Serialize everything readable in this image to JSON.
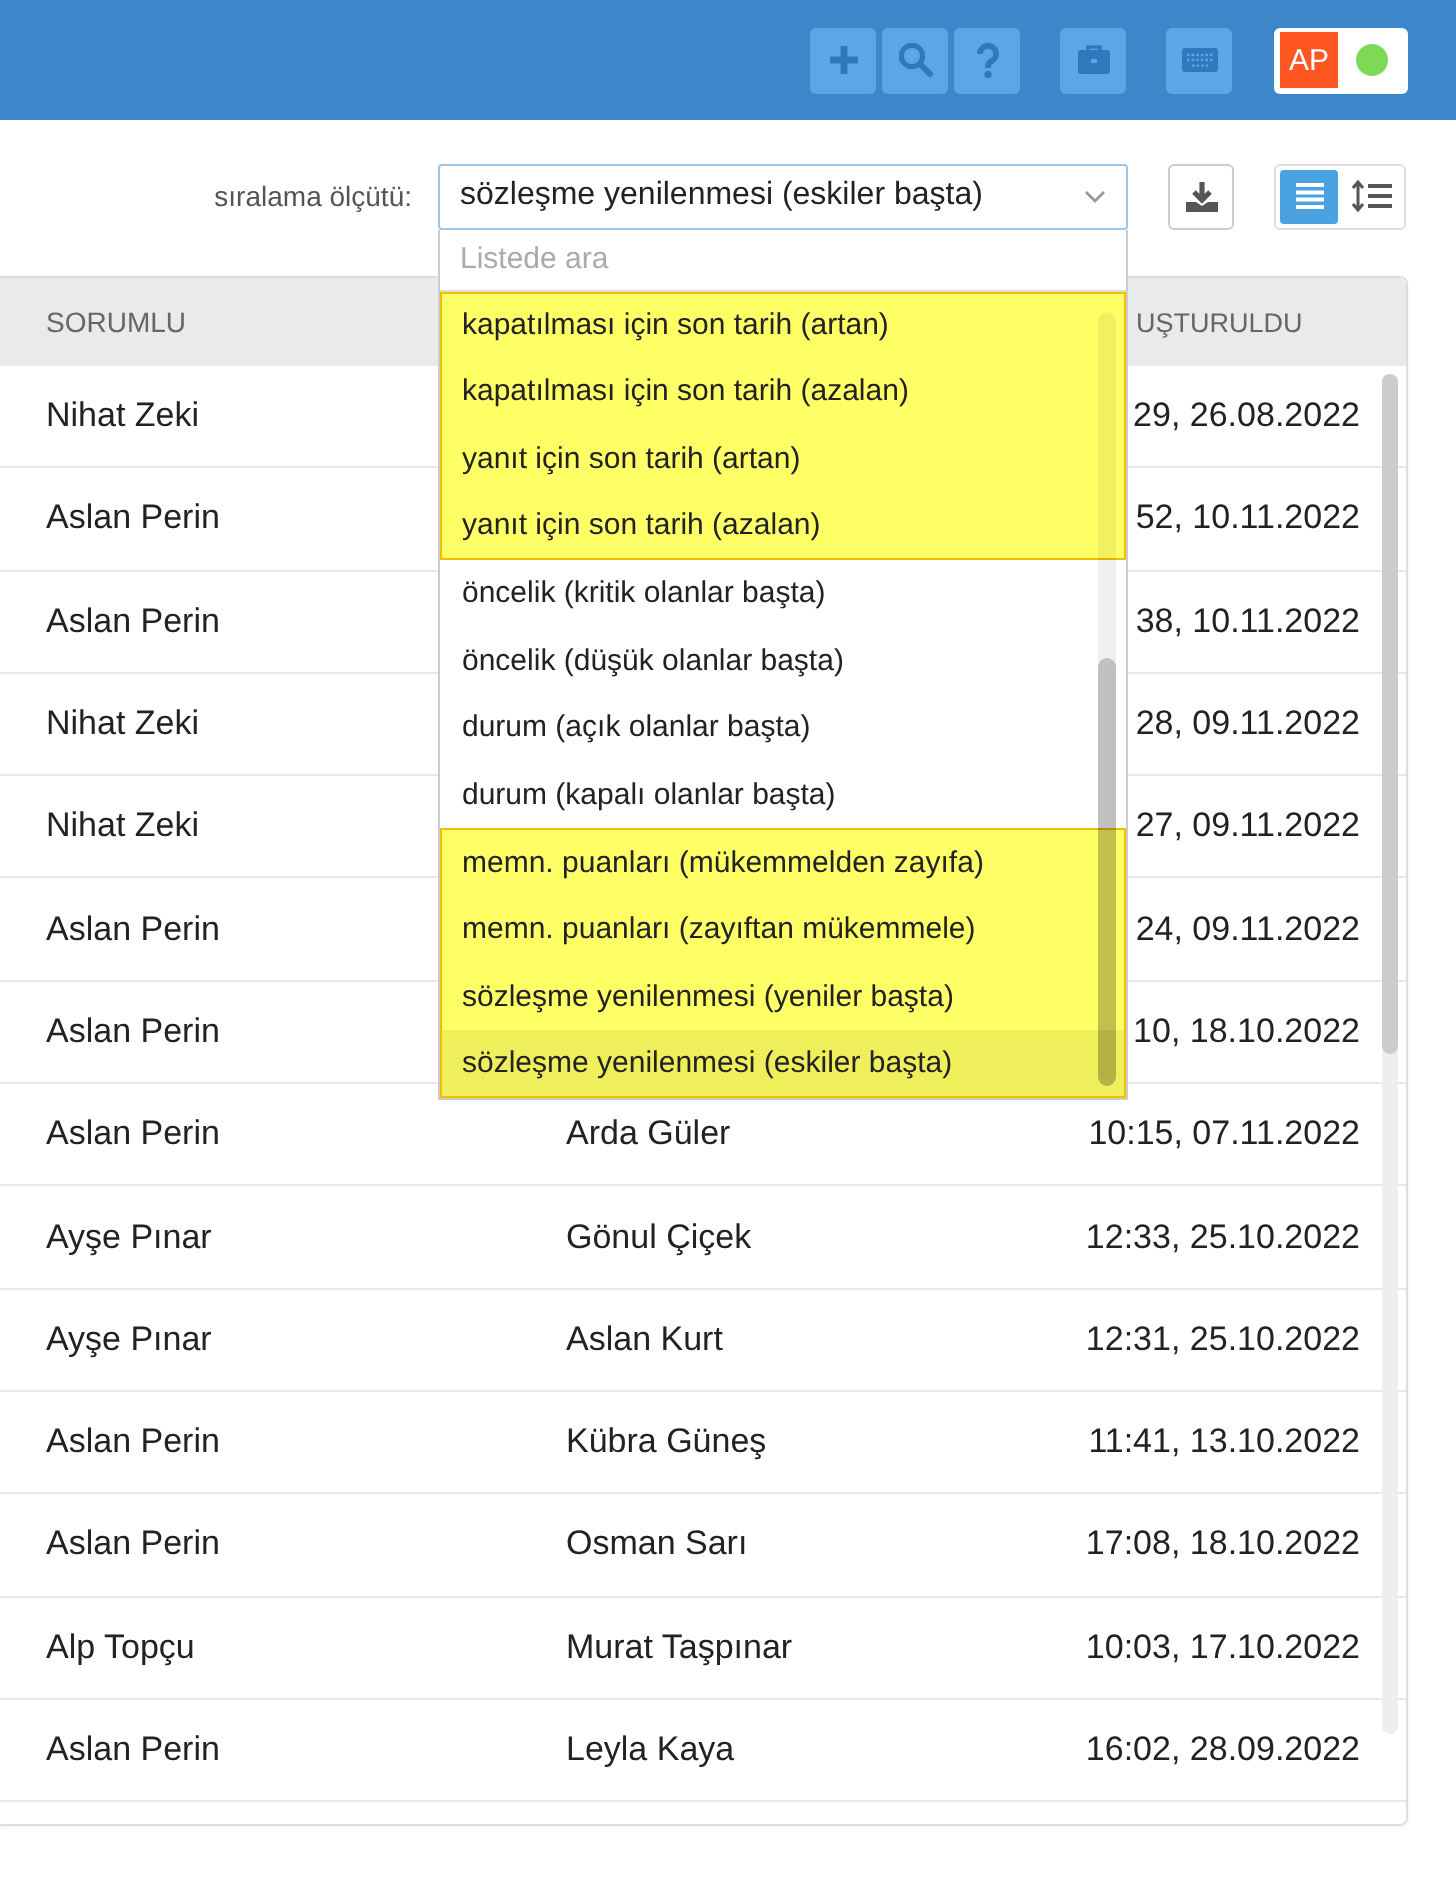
{
  "header": {
    "tool_buttons": [
      {
        "kind": "add"
      },
      {
        "kind": "search"
      },
      {
        "kind": "help"
      },
      {
        "kind": "briefcase"
      },
      {
        "kind": "keyboard"
      }
    ],
    "user": {
      "initials": "AP",
      "online": true
    }
  },
  "toolbar": {
    "sort_label": "sıralama ölçütü:",
    "sort_value": "sözleşme yenilenmesi (eskiler başta)",
    "view_modes": [
      {
        "kind": "list",
        "selected": true
      },
      {
        "kind": "compact",
        "selected": false
      }
    ]
  },
  "sort_dropdown": {
    "search_placeholder": "Listede ara",
    "options": [
      {
        "label": "kapatılması için son tarih (artan)",
        "highlighted": true,
        "selected": false
      },
      {
        "label": "kapatılması için son tarih (azalan)",
        "highlighted": true,
        "selected": false
      },
      {
        "label": "yanıt için son tarih (artan)",
        "highlighted": true,
        "selected": false
      },
      {
        "label": "yanıt için son tarih (azalan)",
        "highlighted": true,
        "selected": false
      },
      {
        "label": "öncelik (kritik olanlar başta)",
        "highlighted": false,
        "selected": false
      },
      {
        "label": "öncelik (düşük olanlar başta)",
        "highlighted": false,
        "selected": false
      },
      {
        "label": "durum (açık olanlar başta)",
        "highlighted": false,
        "selected": false
      },
      {
        "label": "durum (kapalı olanlar başta)",
        "highlighted": false,
        "selected": false
      },
      {
        "label": "memn. puanları (mükemmelden zayıfa)",
        "highlighted": true,
        "selected": false
      },
      {
        "label": "memn. puanları (zayıftan mükemmele)",
        "highlighted": true,
        "selected": false
      },
      {
        "label": "sözleşme yenilenmesi (yeniler başta)",
        "highlighted": true,
        "selected": false
      },
      {
        "label": "sözleşme yenilenmesi (eskiler başta)",
        "highlighted": true,
        "selected": true
      }
    ]
  },
  "table": {
    "headers": {
      "column_1": "SORUMLU",
      "column_3": "UŞTURULDU"
    },
    "rows": [
      {
        "column_1": "Nihat Zeki",
        "column_3": "29, 26.08.2022"
      },
      {
        "column_1": "Aslan Perin",
        "column_3": "52, 10.11.2022"
      },
      {
        "column_1": "Aslan Perin",
        "column_3": "38, 10.11.2022"
      },
      {
        "column_1": "Nihat Zeki",
        "column_3": "28, 09.11.2022"
      },
      {
        "column_1": "Nihat Zeki",
        "column_3": "27, 09.11.2022"
      },
      {
        "column_1": "Aslan Perin",
        "column_3": "24, 09.11.2022"
      },
      {
        "column_1": "Aslan Perin",
        "column_3": "10, 18.10.2022"
      },
      {
        "column_1": "Aslan Perin",
        "column_2": "Arda Güler",
        "column_3": "10:15, 07.11.2022"
      },
      {
        "column_1": "Ayşe Pınar",
        "column_2": "Gönul Çiçek",
        "column_3": "12:33, 25.10.2022"
      },
      {
        "column_1": "Ayşe Pınar",
        "column_2": "Aslan Kurt",
        "column_3": "12:31, 25.10.2022"
      },
      {
        "column_1": "Aslan Perin",
        "column_2": "Kübra Güneş",
        "column_3": "11:41, 13.10.2022"
      },
      {
        "column_1": "Aslan Perin",
        "column_2": "Osman Sarı",
        "column_3": "17:08, 18.10.2022"
      },
      {
        "column_1": "Alp Topçu",
        "column_2": "Murat Taşpınar",
        "column_3": "10:03, 17.10.2022"
      },
      {
        "column_1": "Aslan Perin",
        "column_2": "Leyla Kaya",
        "column_3": "16:02, 28.09.2022"
      }
    ]
  }
}
